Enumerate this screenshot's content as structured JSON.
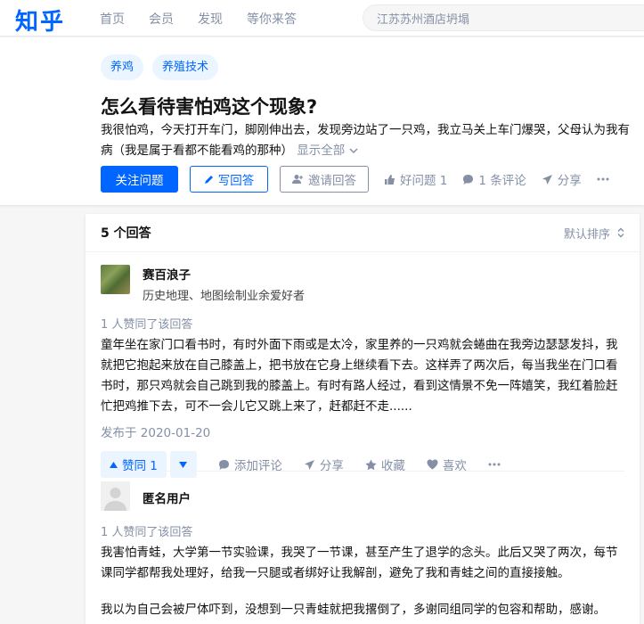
{
  "header": {
    "logo": "知乎",
    "nav": [
      "首页",
      "会员",
      "发现",
      "等你来答"
    ],
    "search_placeholder": "江苏苏州酒店坍塌"
  },
  "question": {
    "tags": [
      "养鸡",
      "养殖技术"
    ],
    "title": "怎么看待害怕鸡这个现象?",
    "description_line1": "我很怕鸡，今天打开车门，脚刚伸出去，发现旁边站了一只鸡，我立马关上车门爆哭，父母认为我有",
    "description_line2": "病（我是属于看都不能看鸡的那种）",
    "show_all": "显示全部",
    "actions": {
      "follow": "关注问题",
      "write": "写回答",
      "invite": "邀请回答",
      "good": "好问题 1",
      "comments": "1 条评论",
      "share": "分享"
    }
  },
  "answers_panel": {
    "count": "5 个回答",
    "sort": "默认排序"
  },
  "answers": [
    {
      "author": "赛百浪子",
      "bio": "历史地理、地图绘制业余爱好者",
      "votes": "1 人赞同了该回答",
      "content": "童年坐在家门口看书时，有时外面下雨或是太冷，家里养的一只鸡就会蜷曲在我旁边瑟瑟发抖，我就把它抱起来放在自己膝盖上，把书放在它身上继续看下去。这样弄了两次后，每当我坐在门口看书时，那只鸡就会自己跳到我的膝盖上。有时有路人经过，看到这情景不免一阵嬉笑，我红着脸赶忙把鸡推下去，可不一会儿它又跳上来了，赶都赶不走......",
      "date": "发布于 2020-01-20",
      "actions": {
        "upvote": "赞同 1",
        "comment": "添加评论",
        "share": "分享",
        "collect": "收藏",
        "like": "喜欢"
      }
    },
    {
      "author": "匿名用户",
      "votes": "1 人赞同了该回答",
      "paragraph1": "我害怕青蛙，大学第一节实验课，我哭了一节课，甚至产生了退学的念头。此后又哭了两次，每节课同学都帮我处理好，给我一只腿或者绑好让我解剖，避免了我和青蛙之间的直接接触。",
      "paragraph2": "我以为自己会被尸体吓到，没想到一只青蛙就把我撂倒了，多谢同组同学的包容和帮助，感谢。"
    }
  ],
  "colors": {
    "brand": "#0066ff",
    "muted": "#8590a6",
    "tag_bg": "#ebf5ff"
  }
}
